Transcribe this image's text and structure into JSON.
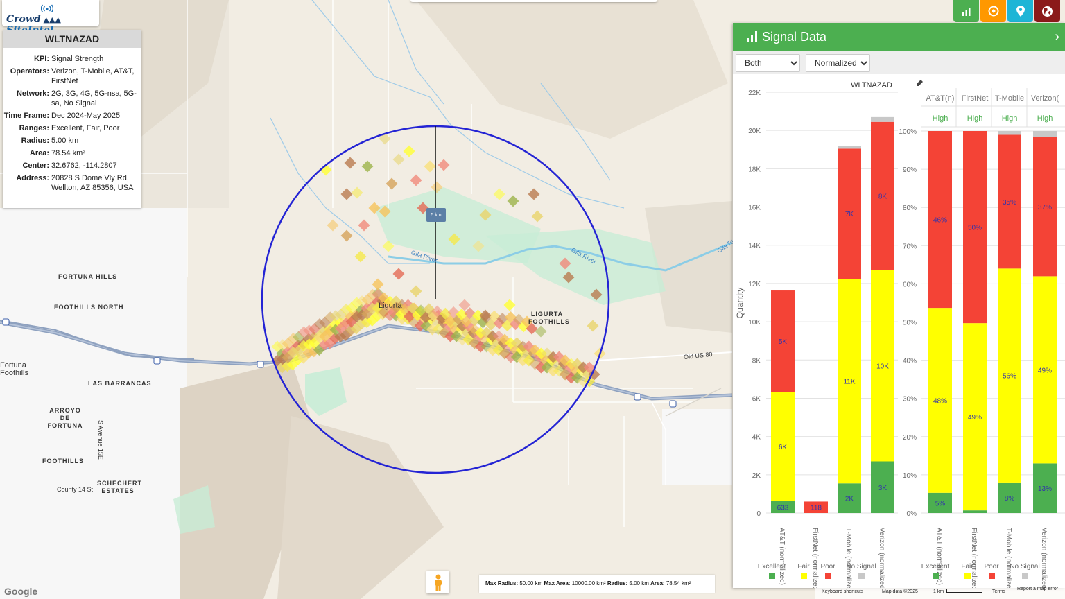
{
  "logo": {
    "crowd": "Crowd",
    "site_intel": "SiteIntel"
  },
  "info": {
    "title": "WLTNAZAD",
    "rows": [
      {
        "key": "KPI:",
        "value": "Signal Strength"
      },
      {
        "key": "Operators:",
        "value": "Verizon, T-Mobile, AT&T, FirstNet"
      },
      {
        "key": "Network:",
        "value": "2G, 3G, 4G, 5G-nsa, 5G-sa, No Signal"
      },
      {
        "key": "Time Frame:",
        "value": "Dec 2024-May 2025"
      },
      {
        "key": "Ranges:",
        "value": "Excellent, Fair, Poor"
      },
      {
        "key": "Radius:",
        "value": "5.00 km"
      },
      {
        "key": "Area:",
        "value": "78.54 km²"
      },
      {
        "key": "Center:",
        "value": "32.6762, -114.2807"
      },
      {
        "key": "Address:",
        "value": "20828 S Dome Vly Rd, Wellton, AZ 85356, USA"
      }
    ]
  },
  "top_buttons": [
    {
      "name": "stats",
      "color": "#4caf50",
      "icon": "bar-chart-icon"
    },
    {
      "name": "target",
      "color": "#ff9800",
      "icon": "target-icon"
    },
    {
      "name": "location",
      "color": "#1eb5d6",
      "icon": "map-pin-icon"
    },
    {
      "name": "globe",
      "color": "#8b1a1a",
      "icon": "globe-icon"
    }
  ],
  "map": {
    "labels": {
      "fortuna_hills": "FORTUNA HILLS",
      "foothills_north": "FOOTHILLS NORTH",
      "fortuna_foothills": "Fortuna Foothills",
      "las_barrancas": "LAS BARRANCAS",
      "arroyo_de_fortuna": "ARROYO DE FORTUNA",
      "foothills": "FOOTHILLS",
      "schechert_estates": "SCHECHERT ESTATES",
      "county_14_st": "County 14 St",
      "s_avenue_15e": "S Avenue 15E",
      "ligurta": "Ligurta",
      "ligurta_foothills": "LIGURTA FOOTHILLS",
      "old_us_80": "Old US 80",
      "gila_river_1": "Gila River",
      "gila_river_2": "Gila River",
      "gila_river_3": "Gila Ri"
    },
    "radius_label": "5 km"
  },
  "panel": {
    "title": "Signal Data",
    "filter_options": [
      "Both"
    ],
    "filter_selected": "Both",
    "mode_options": [
      "Normalized"
    ],
    "mode_selected": "Normalized"
  },
  "chart_data": [
    {
      "type": "bar",
      "title": "WLTNAZAD",
      "stacked": true,
      "ylabel": "Quantity",
      "ylim": [
        0,
        22000
      ],
      "yticks": [
        "0",
        "2K",
        "4K",
        "6K",
        "8K",
        "10K",
        "12K",
        "14K",
        "16K",
        "18K",
        "20K",
        "22K"
      ],
      "categories": [
        "AT&T (normalized)",
        "FirstNet (normalized)",
        "T-Mobile (normalized)",
        "Verizon (normalized)"
      ],
      "series": [
        {
          "name": "Excellent",
          "color": "#4caf50",
          "values": [
            633,
            0,
            1550,
            2700
          ],
          "labels": [
            "633",
            "",
            "2K",
            "3K"
          ]
        },
        {
          "name": "Fair",
          "color": "#ffff00",
          "values": [
            5700,
            0,
            10700,
            10000
          ],
          "labels": [
            "6K",
            "",
            "11K",
            "10K"
          ]
        },
        {
          "name": "Poor",
          "color": "#f44336",
          "values": [
            5300,
            600,
            6800,
            7750
          ],
          "labels": [
            "5K",
            "118",
            "7K",
            "8K"
          ]
        },
        {
          "name": "No Signal",
          "color": "#c8c8c8",
          "values": [
            0,
            0,
            150,
            250
          ],
          "labels": [
            "",
            "",
            "",
            ""
          ]
        }
      ]
    },
    {
      "type": "bar",
      "stacked": true,
      "ylim": [
        0,
        100
      ],
      "yticks": [
        "0%",
        "10%",
        "20%",
        "30%",
        "40%",
        "50%",
        "60%",
        "70%",
        "80%",
        "90%",
        "100%"
      ],
      "column_headers": [
        "AT&T(n)",
        "FirstNet",
        "T-Mobile",
        "Verizon("
      ],
      "column_values": [
        "High",
        "High",
        "High",
        "High"
      ],
      "categories": [
        "AT&T (normalized)",
        "FirstNet (normalized)",
        "T-Mobile (normalized)",
        "Verizon (normalized)"
      ],
      "series": [
        {
          "name": "Excellent",
          "color": "#4caf50",
          "values": [
            5.3,
            0.7,
            8,
            13
          ],
          "labels": [
            "5%",
            "",
            "8%",
            "13%"
          ]
        },
        {
          "name": "Fair",
          "color": "#ffff00",
          "values": [
            48.4,
            49,
            56,
            49
          ],
          "labels": [
            "48%",
            "49%",
            "56%",
            "49%"
          ]
        },
        {
          "name": "Poor",
          "color": "#f44336",
          "values": [
            46.3,
            50.3,
            35,
            36.5
          ],
          "labels": [
            "46%",
            "50%",
            "35%",
            "37%"
          ]
        },
        {
          "name": "No Signal",
          "color": "#c8c8c8",
          "values": [
            0,
            0,
            1,
            1.5
          ],
          "labels": [
            "",
            "",
            "",
            ""
          ]
        }
      ]
    }
  ],
  "attribution": {
    "max_radius_label": "Max Radius:",
    "max_radius": "50.00 km",
    "max_area_label": "Max Area:",
    "max_area": "10000.00 km²",
    "radius_label": "Radius:",
    "radius": "5.00 km",
    "area_label": "Area:",
    "area": "78.54 km²"
  },
  "footer": {
    "google": "Google",
    "keyboard": "Keyboard shortcuts",
    "map_data": "Map data ©2025",
    "scale": "1 km",
    "terms": "Terms",
    "report": "Report a map error"
  }
}
